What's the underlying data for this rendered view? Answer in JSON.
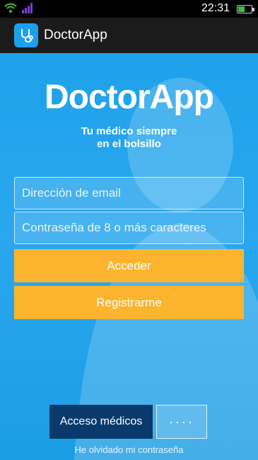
{
  "status": {
    "time": "22:31",
    "icons": [
      "wifi-icon",
      "signal-icon",
      "battery-icon"
    ]
  },
  "appbar": {
    "icon": "stethoscope-icon",
    "title": "DoctorApp"
  },
  "hero": {
    "logo": "DoctorApp",
    "tagline_line1": "Tu médico siempre",
    "tagline_line2": "en el bolsillo"
  },
  "form": {
    "email_placeholder": "Dirección de email",
    "password_placeholder": "Contraseña de 8 o más caracteres",
    "login_label": "Acceder",
    "register_label": "Registrarme"
  },
  "footer": {
    "medicos_label": "Acceso médicos",
    "pin_label": "····",
    "forgot_label": "He olvidado mi contraseña"
  },
  "colors": {
    "background": "#1ea0e6",
    "accent": "#fcb42e",
    "medicos_bg": "#0a3a6b",
    "appbar": "#1b1b1b"
  }
}
